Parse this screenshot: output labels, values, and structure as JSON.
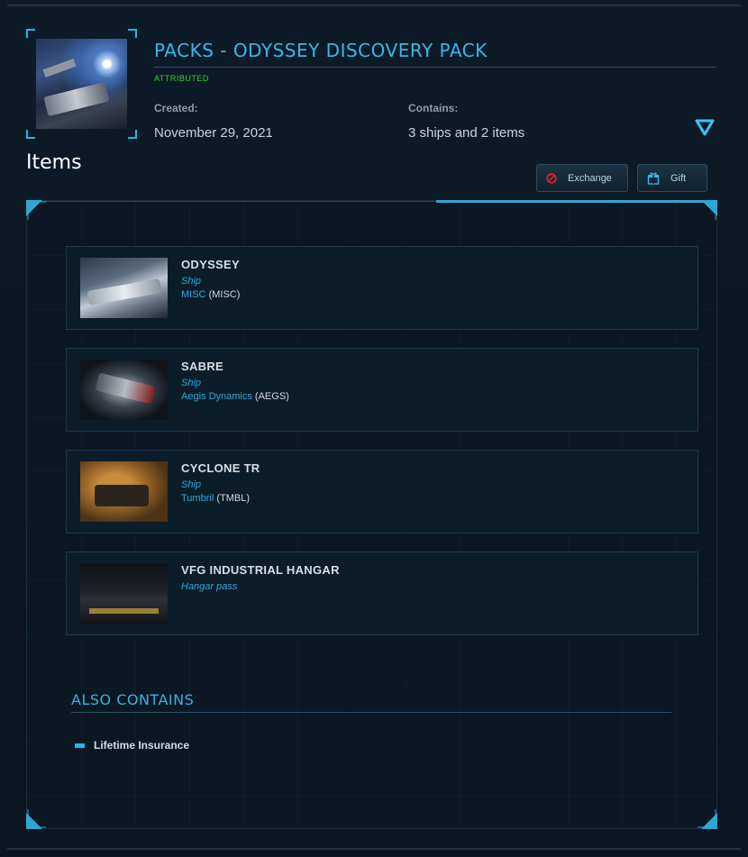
{
  "header": {
    "title": "PACKS - ODYSSEY DISCOVERY PACK",
    "status": "ATTRIBUTED",
    "created_label": "Created:",
    "created_value": "November 29, 2021",
    "contains_label": "Contains:",
    "contains_value": "3 ships and 2 items"
  },
  "items_section": {
    "title": "Items",
    "exchange_label": "Exchange",
    "gift_label": "Gift"
  },
  "items": [
    {
      "name": "ODYSSEY",
      "kind": "Ship",
      "manufacturer": "MISC",
      "code": "(MISC)"
    },
    {
      "name": "SABRE",
      "kind": "Ship",
      "manufacturer": "Aegis Dynamics",
      "code": "(AEGS)"
    },
    {
      "name": "CYCLONE TR",
      "kind": "Ship",
      "manufacturer": "Tumbril",
      "code": "(TMBL)"
    },
    {
      "name": "VFG INDUSTRIAL HANGAR",
      "kind": "Hangar pass",
      "manufacturer": "",
      "code": ""
    }
  ],
  "also_contains": {
    "title": "ALSO CONTAINS",
    "entries": [
      "Lifetime Insurance"
    ]
  },
  "colors": {
    "accent": "#39b7e8",
    "status_green": "#35d035",
    "background": "#0b1622"
  },
  "icons": {
    "exchange": "exchange-ban-icon",
    "gift": "gift-box-icon",
    "expand": "triangle-down-icon",
    "bullet": "dash-bullet-icon"
  }
}
